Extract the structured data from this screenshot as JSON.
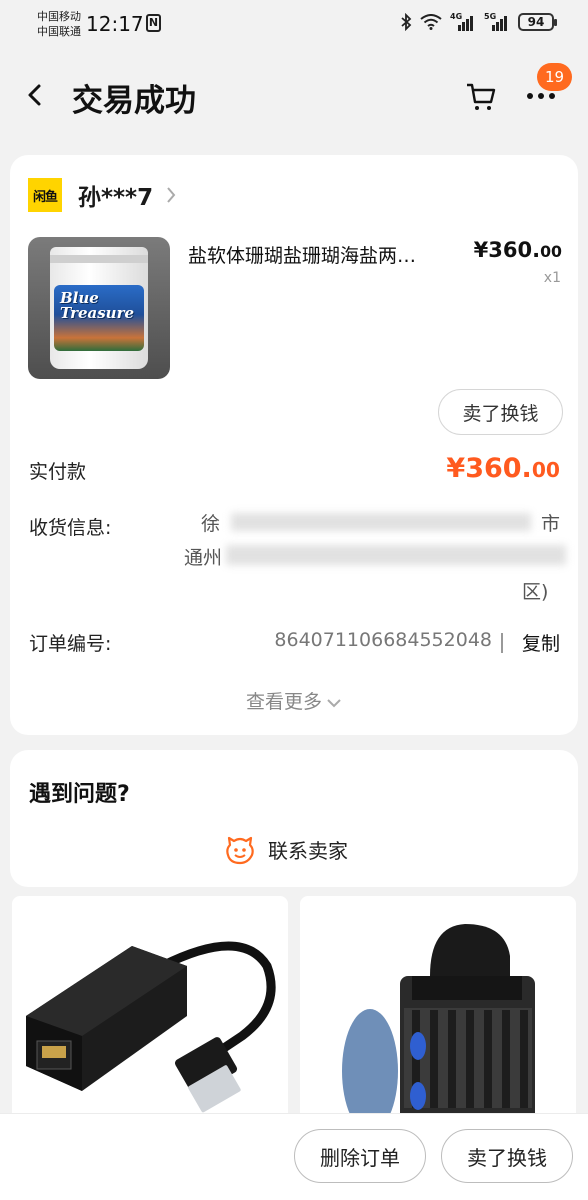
{
  "status_bar": {
    "carrier_1": "中国移动",
    "carrier_2": "中国联通",
    "time": "12:17",
    "nfc": "N",
    "net_1": "4G",
    "net_2": "5G",
    "battery": "94"
  },
  "nav": {
    "title": "交易成功",
    "back_icon": "chevron-left-icon",
    "cart_icon": "cart-icon",
    "more_icon": "more-dots-icon",
    "badge_count": "19"
  },
  "order": {
    "shop_logo_text": "闲鱼",
    "shop_name": "孙***7",
    "product_title": "盐软体珊瑚盐珊瑚海盐两…",
    "product_image_text": "Blue Treasure",
    "price_main": "¥360.",
    "price_cents": "00",
    "quantity": "x1",
    "sell_button": "卖了换钱",
    "paid_label": "实付款",
    "paid_main": "¥360.",
    "paid_cents": "00",
    "address_label": "收货信息:",
    "address_line1_start": "徐",
    "address_line1_end": "市",
    "address_line2_start": "通州",
    "address_line3_end": "区)",
    "order_no_label": "订单编号:",
    "order_no": "864071106684552048",
    "copy_label": "复制",
    "view_more": "查看更多"
  },
  "problem": {
    "title": "遇到问题?",
    "contact_label": "联系卖家",
    "contact_icon": "smiley-chat-icon",
    "accent": "#ff6a1f"
  },
  "bottom": {
    "delete_order": "删除订单",
    "sell": "卖了换钱"
  },
  "colors": {
    "accent": "#ff5a1f",
    "badge": "#ff6a1f",
    "shop_logo_bg": "#ffd400",
    "background": "#f2f2f2"
  }
}
